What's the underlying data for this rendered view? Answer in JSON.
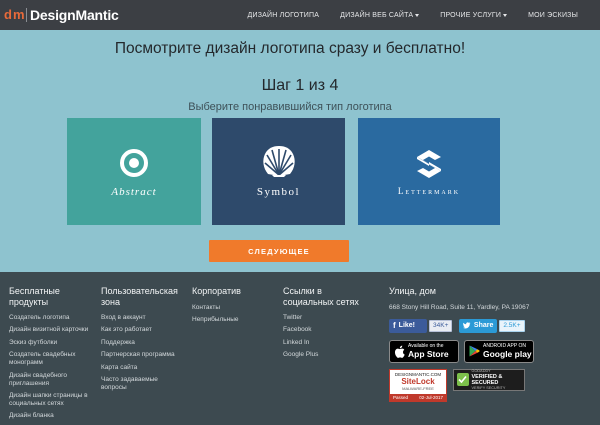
{
  "nav": {
    "logo_mark_d": "d",
    "logo_mark_m": "m",
    "logo_text": "DesignMantic",
    "links": [
      {
        "label": "ДИЗАЙН ЛОГОТИПА",
        "dropdown": false
      },
      {
        "label": "ДИЗАЙН ВЕБ САЙТА",
        "dropdown": true
      },
      {
        "label": "ПРОЧИЕ УСЛУГИ",
        "dropdown": true
      },
      {
        "label": "МОИ ЭСКИЗЫ",
        "dropdown": false
      }
    ]
  },
  "hero": {
    "headline": "Посмотрите дизайн логотипа сразу и бесплатно!",
    "step_word": "Шаг",
    "step_current": "1",
    "step_of": "из",
    "step_total": "4",
    "subtitle": "Выберите понравившийся тип логотипа",
    "cards": [
      {
        "label": "Abstract",
        "icon": "abstract-ring-icon",
        "color": "#43a39c"
      },
      {
        "label": "Symbol",
        "icon": "shell-icon",
        "color": "#2e4a6b"
      },
      {
        "label": "Lettermark",
        "icon": "letter-s-icon",
        "color": "#2a6aa0"
      }
    ],
    "next_button": "СЛЕДУЮЩЕЕ",
    "accent_color": "#f07a2b"
  },
  "footer": {
    "col1": {
      "title": "Бесплатные продукты",
      "links": [
        "Создатель логотипа",
        "Дизайн визитной карточки",
        "Эскиз футболки",
        "Создатель свадебных монограмм",
        "Дизайн свадебного приглашения",
        "Дизайн шапки страницы в социальных сетях",
        "Дизайн бланка"
      ]
    },
    "col2": {
      "title": "Пользовательская зона",
      "links": [
        "Вход в аккаунт",
        "Как это работает",
        "Поддержка",
        "Партнерская программа",
        "Карта сайта",
        "Часто задаваемые вопросы"
      ]
    },
    "col3": {
      "title": "Корпоратив",
      "links": [
        "Контакты",
        "Неприбыльные"
      ]
    },
    "col4": {
      "title": "Ссылки в социальных сетях",
      "links": [
        "Twitter",
        "Facebook",
        "Linked In",
        "Google Plus"
      ]
    },
    "col5": {
      "title": "Улица, дом",
      "address": "668 Stony Hill Road, Suite 11, Yardley, PA 19067",
      "facebook_label": "Like!",
      "facebook_count": "34K+",
      "twitter_label": "Share",
      "twitter_count": "2.5K+",
      "appstore_small": "Available on the",
      "appstore_big": "App Store",
      "googleplay_small": "ANDROID APP ON",
      "googleplay_big": "Google play",
      "sitelock_top": "DESIGNMANTIC.COM",
      "sitelock_brand": "SiteLock",
      "sitelock_sub": "MALWARE-FREE",
      "sitelock_passed": "Passed",
      "sitelock_date": "02-Jul-2017",
      "godaddy_small": "GODADDY",
      "godaddy_big": "VERIFIED & SECURED",
      "godaddy_date": "VERIFY SECURITY"
    }
  }
}
